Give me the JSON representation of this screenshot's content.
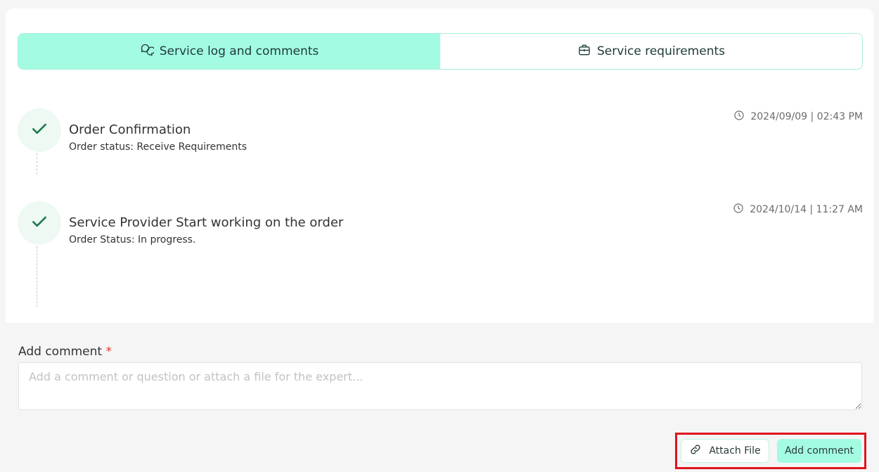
{
  "tabs": [
    {
      "label": "Service log and comments",
      "icon": "chat-bubbles-icon",
      "active": true
    },
    {
      "label": "Service requirements",
      "icon": "briefcase-icon",
      "active": false
    }
  ],
  "events": [
    {
      "title": "Order Confirmation",
      "status": "Order status: Receive Requirements",
      "time": "2024/09/09 | 02:43 PM",
      "icon": "check-icon"
    },
    {
      "title": "Service Provider Start working on the order",
      "status": "Order Status: In progress.",
      "time": "2024/10/14 | 11:27 AM",
      "icon": "check-icon"
    }
  ],
  "comment": {
    "label": "Add comment",
    "required_mark": "*",
    "placeholder": "Add a comment or question or attach a file for the expert...",
    "value": ""
  },
  "actions": {
    "attach_label": "Attach File",
    "add_label": "Add comment"
  },
  "colors": {
    "accent": "#a3fbe2",
    "check": "#1e7a4c",
    "required": "#e03a2e",
    "highlight_border": "#e0141e"
  }
}
